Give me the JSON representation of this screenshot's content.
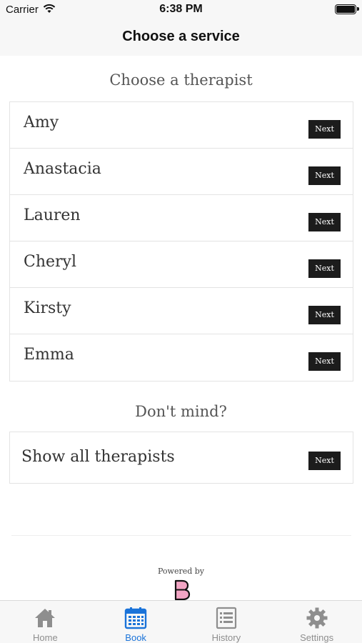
{
  "status_bar": {
    "carrier": "Carrier",
    "time": "6:38 PM"
  },
  "nav": {
    "title": "Choose a service"
  },
  "therapists_section": {
    "heading": "Choose a therapist",
    "items": [
      {
        "name": "Amy",
        "button": "Next"
      },
      {
        "name": "Anastacia",
        "button": "Next"
      },
      {
        "name": "Lauren",
        "button": "Next"
      },
      {
        "name": "Cheryl",
        "button": "Next"
      },
      {
        "name": "Kirsty",
        "button": "Next"
      },
      {
        "name": "Emma",
        "button": "Next"
      }
    ]
  },
  "dont_mind_section": {
    "heading": "Don't mind?",
    "item": {
      "name": "Show all therapists",
      "button": "Next"
    }
  },
  "footer": {
    "powered_by": "Powered by"
  },
  "tab_bar": {
    "tabs": [
      {
        "label": "Home",
        "icon": "home-icon",
        "active": false
      },
      {
        "label": "Book",
        "icon": "calendar-icon",
        "active": true
      },
      {
        "label": "History",
        "icon": "list-icon",
        "active": false
      },
      {
        "label": "Settings",
        "icon": "gear-icon",
        "active": false
      }
    ]
  },
  "colors": {
    "accent": "#1a73d9",
    "button_bg": "#1c1c1c",
    "inactive": "#8e8e8e",
    "logo_pink": "#f2a5c4"
  }
}
